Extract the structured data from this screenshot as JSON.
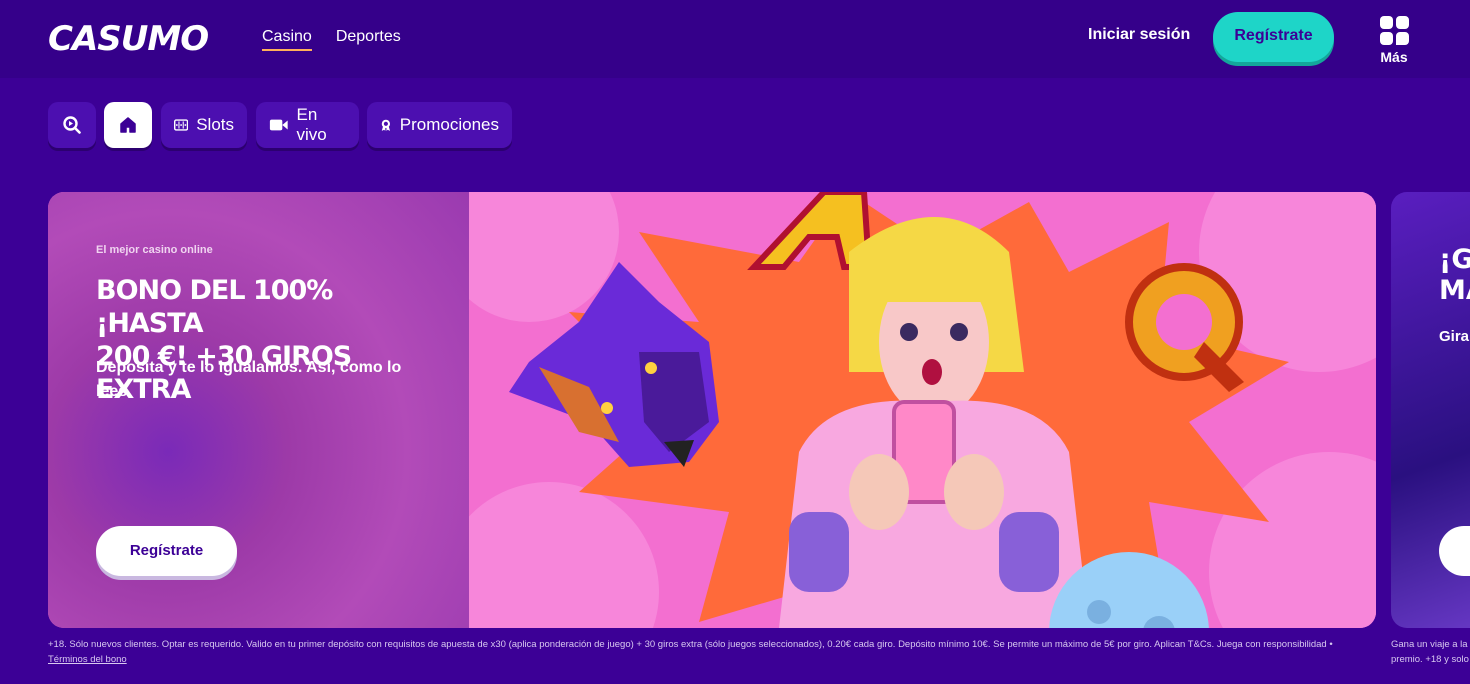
{
  "header": {
    "logo": "CASUMO",
    "nav": [
      {
        "label": "Casino",
        "active": true
      },
      {
        "label": "Deportes",
        "active": false
      }
    ],
    "login_label": "Iniciar sesión",
    "signup_label": "Regístrate",
    "more_label": "Más"
  },
  "categories": [
    {
      "icon": "search-icon",
      "label": ""
    },
    {
      "icon": "home-icon",
      "label": ""
    },
    {
      "icon": "slots-icon",
      "label": "Slots"
    },
    {
      "icon": "video-camera-icon",
      "label": "En vivo"
    },
    {
      "icon": "badge-icon",
      "label": "Promociones"
    }
  ],
  "banner": {
    "eyebrow": "El mejor casino online",
    "headline_line1": "BONO DEL 100% ¡HASTA",
    "headline_line2": "200 €! +30 GIROS EXTRA",
    "subtext": "Deposita y te lo igualamos. Así, como lo lees.",
    "cta_label": "Regístrate",
    "terms": "+18. Sólo nuevos clientes. Optar es requerido. Valido en tu primer depósito con requisitos de apuesta de x30 (aplica ponderación de juego) + 30 giros extra (sólo juegos seleccionados), 0.20€ cada giro. Depósito mínimo 10€. Se permite un máximo de 5€ por giro. Aplican T&Cs. Juega con responsibilidad •",
    "terms_link": "Términos del bono"
  },
  "banner_next": {
    "headline_line1": "¡GA",
    "headline_line2": "MA",
    "subtext": "Gira",
    "terms_line1": "Gana un viaje a la",
    "terms_line2": "premio. +18 y solo"
  },
  "colors": {
    "background": "#3c0096",
    "header": "#35008a",
    "accent_teal": "#1ed5c8",
    "nav_underline": "#ffb05a",
    "banner_pink": "#ee6ac8"
  }
}
